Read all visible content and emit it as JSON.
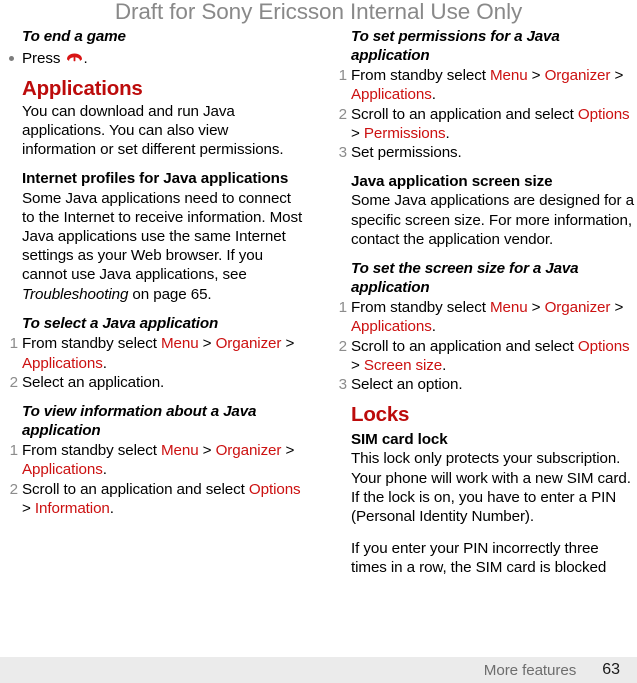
{
  "header": {
    "watermark": "Draft for Sony Ericsson Internal Use Only"
  },
  "colors": {
    "heading_red": "#BC0B0B",
    "link_red": "#CC1111",
    "watermark_gray": "#898989",
    "number_gray": "#8C8C8C",
    "footer_bg": "#EBEBEB",
    "footer_text": "#6E6E6E"
  },
  "left_column": {
    "proc_end_game": {
      "title": "To end a game",
      "bullet": {
        "before": "Press ",
        "icon": "end-call-handset-icon",
        "after": "."
      }
    },
    "applications_heading": "Applications",
    "applications_intro": "You can download and run Java applications. You can also view information or set different permissions.",
    "internet_profiles_heading": "Internet profiles for Java applications",
    "internet_profiles_body_1": "Some Java applications need to connect to the Internet to receive information. Most Java applications use the same Internet settings as your Web browser. If you cannot use Java applications, see ",
    "internet_profiles_body_italic": "Troubleshooting",
    "internet_profiles_body_2": " on page 65.",
    "proc_select_java": {
      "title": "To select a Java application",
      "steps": [
        {
          "num": "1",
          "parts": [
            {
              "t": "From standby select ",
              "c": "black"
            },
            {
              "t": "Menu",
              "c": "red"
            },
            {
              "t": " > ",
              "c": "black"
            },
            {
              "t": "Organizer",
              "c": "red"
            },
            {
              "t": " > ",
              "c": "black"
            },
            {
              "t": "Applications",
              "c": "red"
            },
            {
              "t": ".",
              "c": "black"
            }
          ]
        },
        {
          "num": "2",
          "parts": [
            {
              "t": "Select an application.",
              "c": "black"
            }
          ]
        }
      ]
    },
    "proc_view_info": {
      "title": "To view information about a Java application",
      "steps": [
        {
          "num": "1",
          "parts": [
            {
              "t": "From standby select ",
              "c": "black"
            },
            {
              "t": "Menu",
              "c": "red"
            },
            {
              "t": " > ",
              "c": "black"
            },
            {
              "t": "Organizer",
              "c": "red"
            },
            {
              "t": " > ",
              "c": "black"
            },
            {
              "t": "Applications",
              "c": "red"
            },
            {
              "t": ".",
              "c": "black"
            }
          ]
        },
        {
          "num": "2",
          "parts": [
            {
              "t": "Scroll to an application and select ",
              "c": "black"
            },
            {
              "t": "Options",
              "c": "red"
            },
            {
              "t": " > ",
              "c": "black"
            },
            {
              "t": "Information",
              "c": "red"
            },
            {
              "t": ".",
              "c": "black"
            }
          ]
        }
      ]
    }
  },
  "right_column": {
    "proc_set_permissions": {
      "title": "To set permissions for a Java application",
      "steps": [
        {
          "num": "1",
          "parts": [
            {
              "t": "From standby select ",
              "c": "black"
            },
            {
              "t": "Menu",
              "c": "red"
            },
            {
              "t": " > ",
              "c": "black"
            },
            {
              "t": "Organizer",
              "c": "red"
            },
            {
              "t": " > ",
              "c": "black"
            },
            {
              "t": "Applications",
              "c": "red"
            },
            {
              "t": ".",
              "c": "black"
            }
          ]
        },
        {
          "num": "2",
          "parts": [
            {
              "t": "Scroll to an application and select ",
              "c": "black"
            },
            {
              "t": "Options",
              "c": "red"
            },
            {
              "t": " > ",
              "c": "black"
            },
            {
              "t": "Permissions",
              "c": "red"
            },
            {
              "t": ".",
              "c": "black"
            }
          ]
        },
        {
          "num": "3",
          "parts": [
            {
              "t": "Set permissions.",
              "c": "black"
            }
          ]
        }
      ]
    },
    "screen_size_heading": "Java application screen size",
    "screen_size_body": "Some Java applications are designed for a specific screen size. For more information, contact the application vendor.",
    "proc_set_screen_size": {
      "title": "To set the screen size for a Java application",
      "steps": [
        {
          "num": "1",
          "parts": [
            {
              "t": "From standby select ",
              "c": "black"
            },
            {
              "t": "Menu",
              "c": "red"
            },
            {
              "t": " > ",
              "c": "black"
            },
            {
              "t": "Organizer",
              "c": "red"
            },
            {
              "t": " > ",
              "c": "black"
            },
            {
              "t": "Applications",
              "c": "red"
            },
            {
              "t": ".",
              "c": "black"
            }
          ]
        },
        {
          "num": "2",
          "parts": [
            {
              "t": "Scroll to an application and select ",
              "c": "black"
            },
            {
              "t": "Options",
              "c": "red"
            },
            {
              "t": " > ",
              "c": "black"
            },
            {
              "t": "Screen size",
              "c": "red"
            },
            {
              "t": ".",
              "c": "black"
            }
          ]
        },
        {
          "num": "3",
          "parts": [
            {
              "t": "Select an option.",
              "c": "black"
            }
          ]
        }
      ]
    },
    "locks_heading": "Locks",
    "sim_lock_heading": "SIM card lock",
    "sim_lock_body_1": "This lock only protects your subscription. Your phone will work with a new SIM card. If the lock is on, you have to enter a PIN (Personal Identity Number).",
    "sim_lock_body_2": "If you enter your PIN incorrectly three times in a row, the SIM card is blocked"
  },
  "footer": {
    "section_label": "More features",
    "page_number": "63"
  }
}
